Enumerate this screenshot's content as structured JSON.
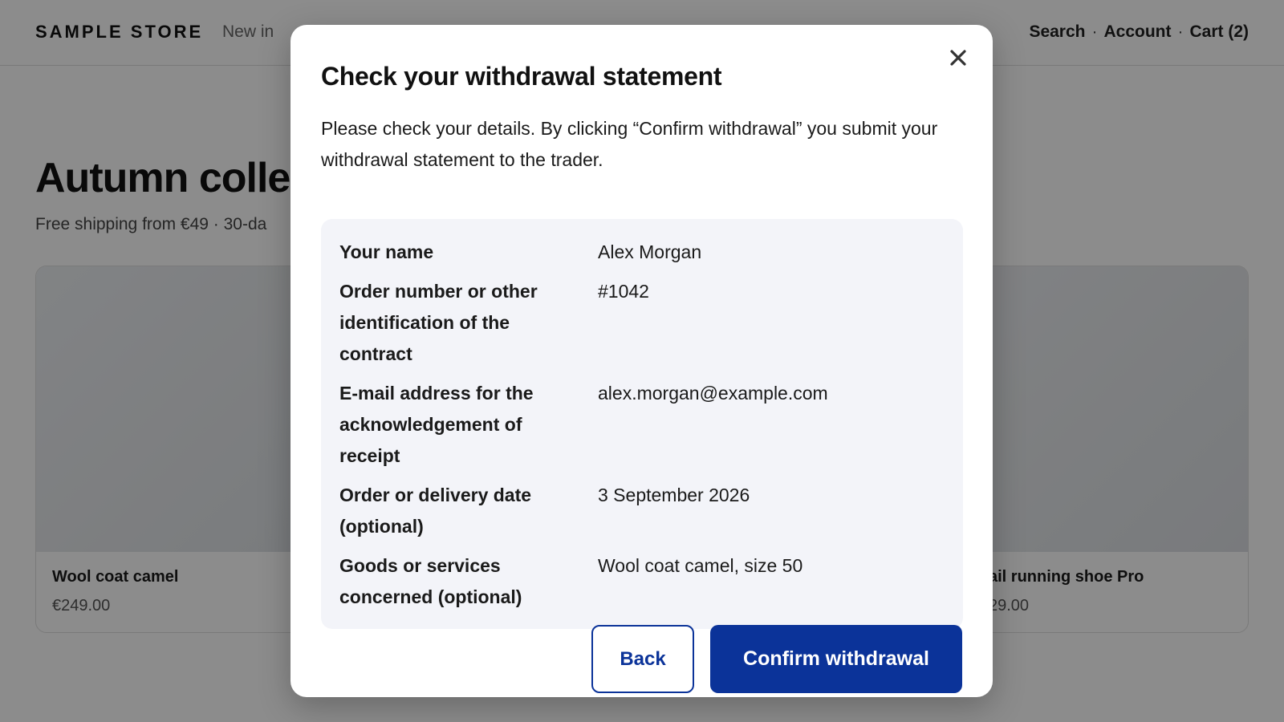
{
  "header": {
    "logo": "SAMPLE STORE",
    "nav_new": "New in",
    "nav_search": "Search",
    "nav_account": "Account",
    "nav_cart": "Cart (2)",
    "separator": "·"
  },
  "main": {
    "title": "Autumn collec",
    "subtitle": "Free shipping from €49 · 30-da",
    "cards": [
      {
        "name": "Wool coat camel",
        "price": "€249.00"
      },
      {
        "name": "ail running shoe Pro",
        "price": "29.00"
      }
    ]
  },
  "dialog": {
    "title": "Check your withdrawal statement",
    "intro": "Please check your details. By clicking “Confirm withdrawal” you submit your withdrawal statement to the trader.",
    "close_icon": "close-icon",
    "fields": [
      {
        "label": "Your name",
        "value": "Alex Morgan"
      },
      {
        "label": "Order number or other identification of the contract",
        "value": "#1042"
      },
      {
        "label": "E-mail address for the acknowledgement of receipt",
        "value": "alex.morgan@example.com"
      },
      {
        "label": "Order or delivery date (optional)",
        "value": "3 September 2026"
      },
      {
        "label": "Goods or services concerned (optional)",
        "value": "Wool coat camel, size 50"
      }
    ],
    "back_label": "Back",
    "confirm_label": "Confirm withdrawal"
  },
  "colors": {
    "primary": "#0b3399",
    "overlay": "rgba(0,0,0,0.45)",
    "summary_bg": "#f3f4f9"
  }
}
